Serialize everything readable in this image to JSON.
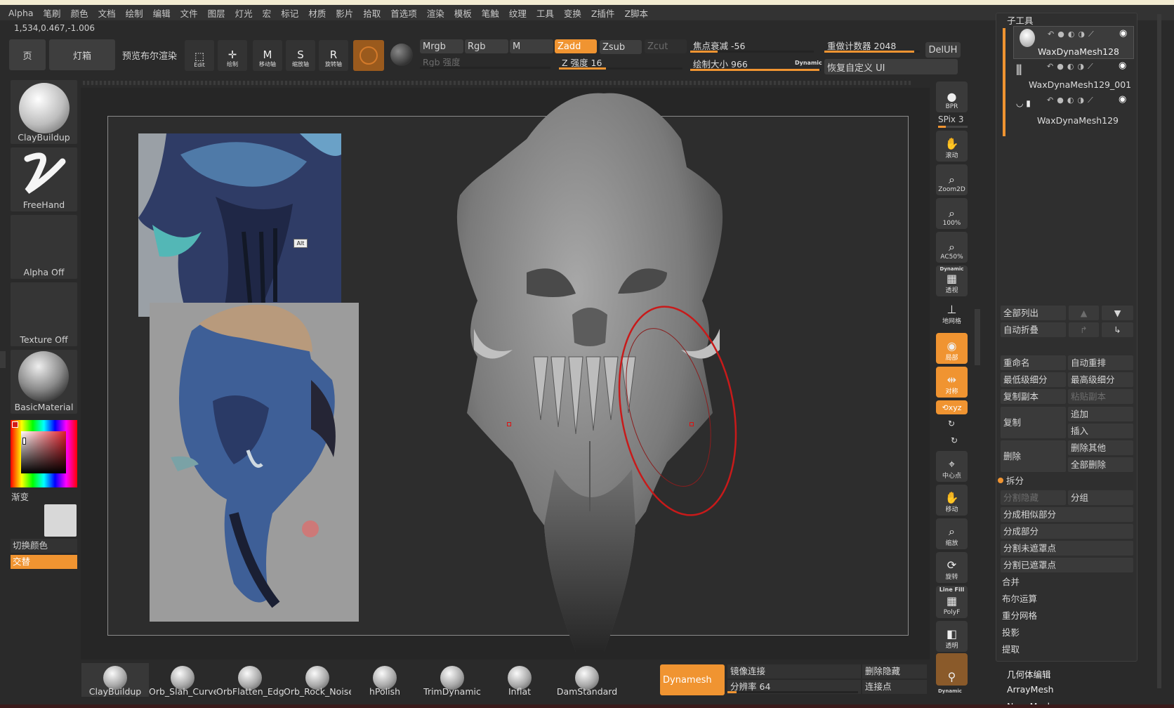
{
  "menu": [
    "Alpha",
    "笔刷",
    "颜色",
    "文档",
    "绘制",
    "编辑",
    "文件",
    "图层",
    "灯光",
    "宏",
    "标记",
    "材质",
    "影片",
    "拾取",
    "首选项",
    "渲染",
    "模板",
    "笔触",
    "纹理",
    "工具",
    "变换",
    "Z插件",
    "Z脚本"
  ],
  "coords": "1,534,0.467,-1.006",
  "toolbar": {
    "home_tab": "页",
    "lightbox": "灯箱",
    "preview_boolean": "预览布尔渲染",
    "edit": "Edit",
    "draw": "绘制",
    "move": "移动轴",
    "scale": "缩放轴",
    "rotate": "旋转轴",
    "mrgb": "Mrgb",
    "rgb": "Rgb",
    "m": "M",
    "rgb_intensity": "Rgb 强度",
    "zadd": "Zadd",
    "zsub": "Zsub",
    "zcut": "Zcut",
    "z_intensity_label": "Z 强度",
    "z_intensity": 16,
    "focal_label": "焦点衰减",
    "focal": -56,
    "draw_size_label": "绘制大小",
    "draw_size": 966,
    "dynamic": "Dynamic",
    "redo_label": "重做计数器",
    "redo": 2048,
    "deluh": "DelUH",
    "restore_ui": "恢复自定义 UI"
  },
  "left": {
    "brush": "ClayBuildup",
    "stroke": "FreeHand",
    "alpha": "Alpha Off",
    "texture": "Texture Off",
    "material": "BasicMaterial",
    "gradient": "渐变",
    "switch_color": "切换颜色",
    "alternate": "交替"
  },
  "canvas": {
    "alt_tag": "Alt"
  },
  "vtools": {
    "bpr": "BPR",
    "spix": "SPix 3",
    "scroll": "滚动",
    "zoom2d": "Zoom2D",
    "zoom100": "100%",
    "ac50": "AC50%",
    "dynamic": "Dynamic",
    "persp": "透视",
    "floor": "地网格",
    "local": "局部",
    "symmetry": "对称",
    "xyz": "⟲xyz",
    "center": "中心点",
    "move": "移动",
    "scale": "缩放",
    "rotate": "旋转",
    "linefill": "Line Fill",
    "polyf": "PolyF",
    "transp": "透明",
    "dynamic2": "Dynamic"
  },
  "subtool": {
    "title": "子工具",
    "items": [
      "WaxDynaMesh128",
      "WaxDynaMesh129_001",
      "WaxDynaMesh129"
    ],
    "list_all": "全部列出",
    "auto_collapse": "自动折叠",
    "rename": "重命名",
    "auto_reorder": "自动重排",
    "lowest_sub": "最低级细分",
    "highest_sub": "最高级细分",
    "duplicate": "复制副本",
    "paste": "粘贴副本",
    "copy": "复制",
    "append": "追加",
    "insert": "插入",
    "delete": "删除",
    "delete_other": "删除其他",
    "delete_all": "全部删除",
    "split": "拆分",
    "split_hidden": "分割隐藏",
    "groups_split": "分组",
    "split_similar": "分成相似部分",
    "split_parts": "分成部分",
    "split_unmasked": "分割未遮罩点",
    "split_masked": "分割已遮罩点",
    "merge": "合并",
    "boolean": "布尔运算",
    "remesh": "重分网格",
    "project": "投影",
    "extract": "提取",
    "geometry": "几何体编辑",
    "arraymesh": "ArrayMesh",
    "nanomesh": "NanoMesh"
  },
  "bottom": {
    "brushes": [
      "ClayBuildup",
      "Orb_Slah_Curve",
      "OrbFlatten_Edge",
      "Orb_Rock_Noise",
      "hPolish",
      "TrimDynamic",
      "Inflat",
      "DamStandard"
    ],
    "dynamesh": "Dynamesh",
    "mirror_weld": "镜像连接",
    "resolution_label": "分辨率",
    "resolution": 64,
    "del_hidden": "删除隐藏",
    "connect": "连接点"
  }
}
